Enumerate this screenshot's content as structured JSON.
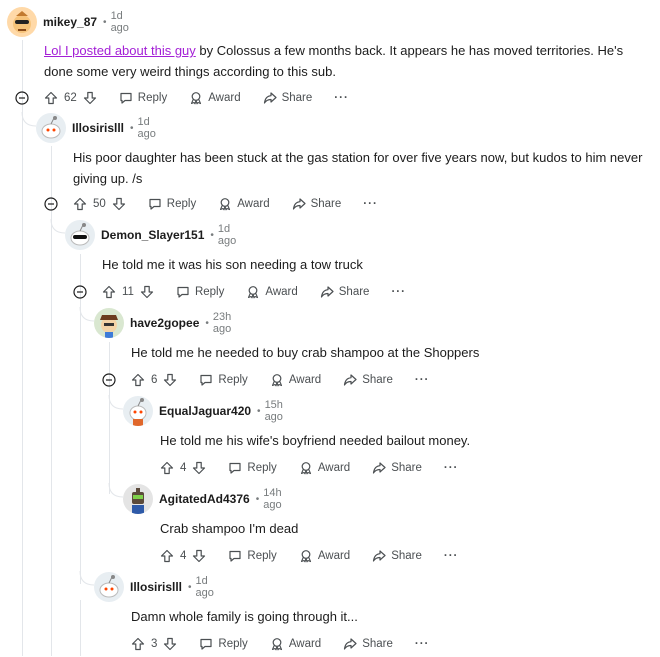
{
  "labels": {
    "reply": "Reply",
    "award": "Award",
    "share": "Share",
    "more": "···",
    "sep": "•"
  },
  "comments": [
    {
      "author": "mikey_87",
      "time": "1d ago",
      "body_link": "Lol I posted about this guy",
      "body_rest": " by Colossus a few months back. It appears he has moved territories. He's done some very weird things according to this sub.",
      "votes": "62"
    },
    {
      "author": "Illosirislll",
      "time": "1d ago",
      "body": "His poor daughter has been stuck at the gas station for over five years now, but kudos to him never giving up. /s",
      "votes": "50"
    },
    {
      "author": "Demon_Slayer151",
      "time": "1d ago",
      "body": "He told me it was his son needing a tow truck",
      "votes": "11"
    },
    {
      "author": "have2gopee",
      "time": "23h ago",
      "body": "He told me he needed to buy crab shampoo at the Shoppers",
      "votes": "6"
    },
    {
      "author": "EqualJaguar420",
      "time": "15h ago",
      "body": "He told me his wife's boyfriend needed bailout money.",
      "votes": "4"
    },
    {
      "author": "AgitatedAd4376",
      "time": "14h ago",
      "body": "Crab shampoo I'm dead",
      "votes": "4"
    },
    {
      "author": "Illosirislll",
      "time": "1d ago",
      "body": "Damn whole family is going through it...",
      "votes": "3"
    }
  ]
}
